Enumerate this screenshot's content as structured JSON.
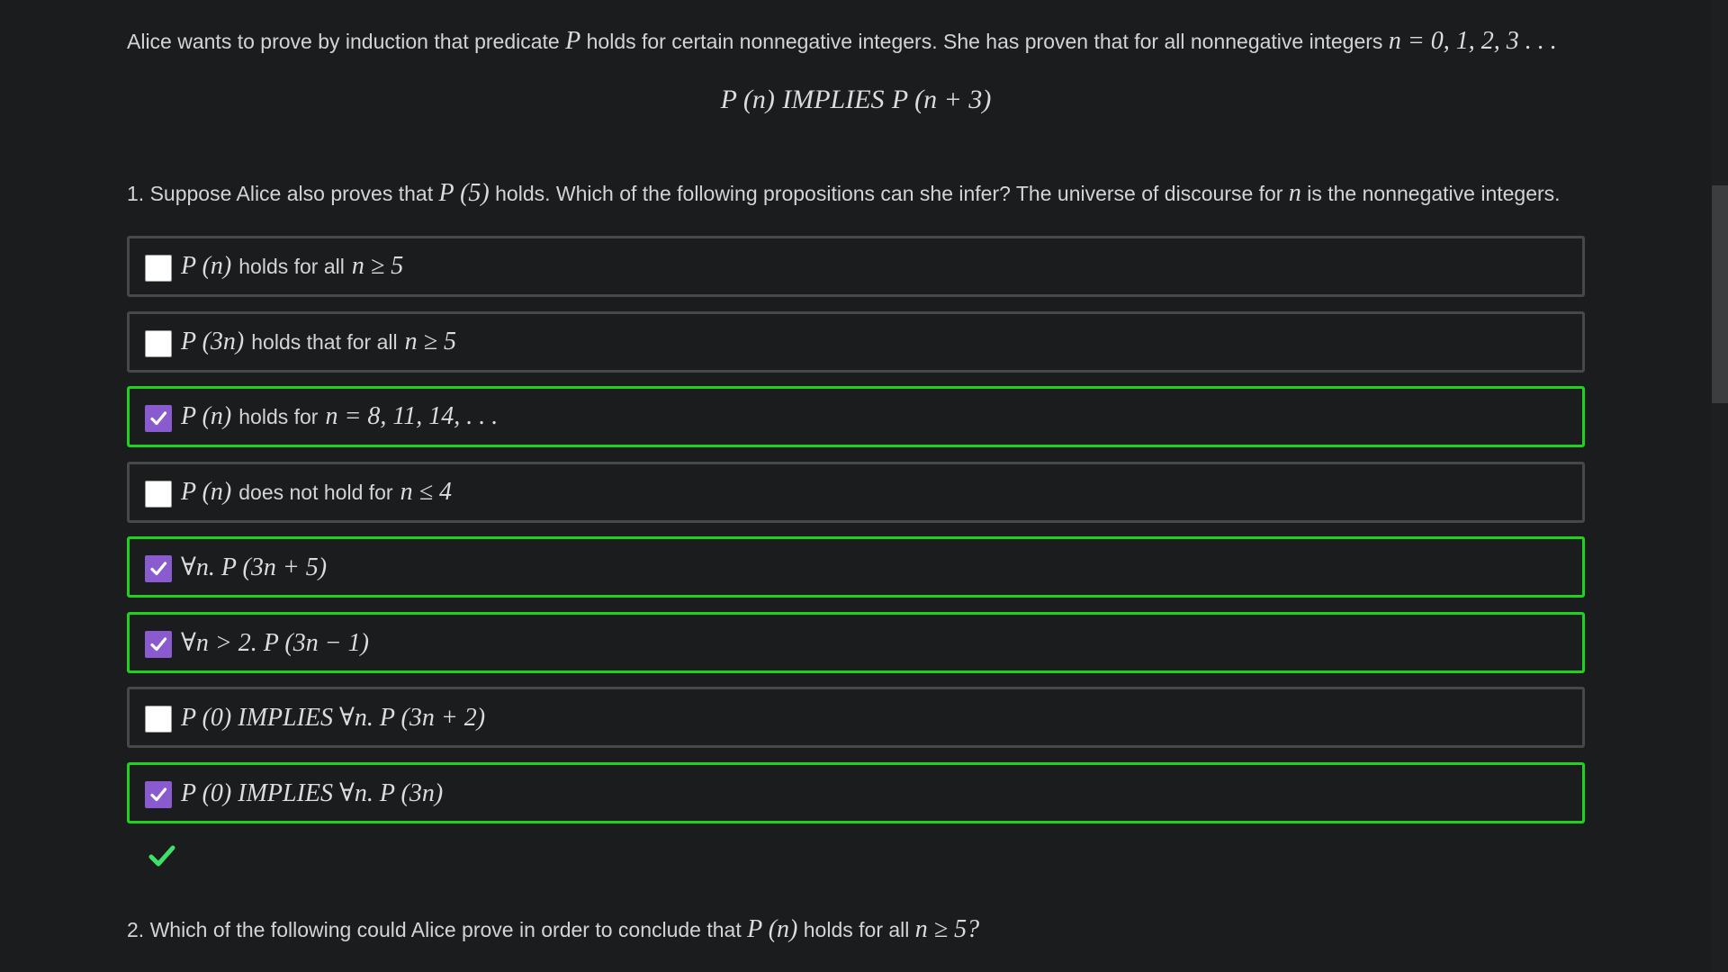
{
  "intro": {
    "text_before": "Alice wants to prove by induction that predicate",
    "pred": "P",
    "text_middle": "holds for certain nonnegative integers. She has proven that for all nonnegative integers",
    "n_values": "n = 0, 1, 2, 3 . . ."
  },
  "display": {
    "lhs": "P (n)",
    "op": "IMPLIES",
    "rhs": "P (n + 3)"
  },
  "question1": {
    "prefix": "1. Suppose Alice also proves that",
    "math": "P (5)",
    "suffix": "holds. Which of the following propositions can she infer? The universe of discourse for",
    "var": "n",
    "suffix2": "is the nonnegative integers."
  },
  "options": [
    {
      "parts": [
        {
          "t": "m",
          "v": "P (n)"
        },
        {
          "t": "p",
          "v": "holds for all"
        },
        {
          "t": "m",
          "v": "n ≥ 5"
        }
      ],
      "checked": false,
      "correct": false
    },
    {
      "parts": [
        {
          "t": "m",
          "v": "P (3n)"
        },
        {
          "t": "p",
          "v": "holds that for all"
        },
        {
          "t": "m",
          "v": "n ≥ 5"
        }
      ],
      "checked": false,
      "correct": false
    },
    {
      "parts": [
        {
          "t": "m",
          "v": "P (n)"
        },
        {
          "t": "p",
          "v": "holds for"
        },
        {
          "t": "m",
          "v": "n = 8, 11, 14, . . ."
        }
      ],
      "checked": true,
      "correct": true
    },
    {
      "parts": [
        {
          "t": "m",
          "v": "P (n)"
        },
        {
          "t": "p",
          "v": "does not hold for"
        },
        {
          "t": "m",
          "v": "n ≤ 4"
        }
      ],
      "checked": false,
      "correct": false
    },
    {
      "parts": [
        {
          "t": "m",
          "v": "∀n.  P (3n + 5)"
        }
      ],
      "checked": true,
      "correct": true
    },
    {
      "parts": [
        {
          "t": "m",
          "v": "∀n > 2. P (3n − 1)"
        }
      ],
      "checked": true,
      "correct": true
    },
    {
      "parts": [
        {
          "t": "m",
          "v": "P (0)  IMPLIES ∀n.  P (3n + 2)"
        }
      ],
      "checked": false,
      "correct": false
    },
    {
      "parts": [
        {
          "t": "m",
          "v": "P (0)  IMPLIES ∀n. P (3n)"
        }
      ],
      "checked": true,
      "correct": true
    }
  ],
  "result": {
    "icon": "checkmark-icon",
    "color": "#3ee06a"
  },
  "question2": {
    "prefix": "2. Which of the following could Alice prove in order to conclude that",
    "math1": "P (n)",
    "middle": "holds for all",
    "math2": "n ≥ 5?"
  },
  "colors": {
    "background": "#1b1c1e",
    "correct_border": "#1fd21f",
    "default_border": "#474849",
    "checkbox_checked": "#8a5bcf"
  }
}
